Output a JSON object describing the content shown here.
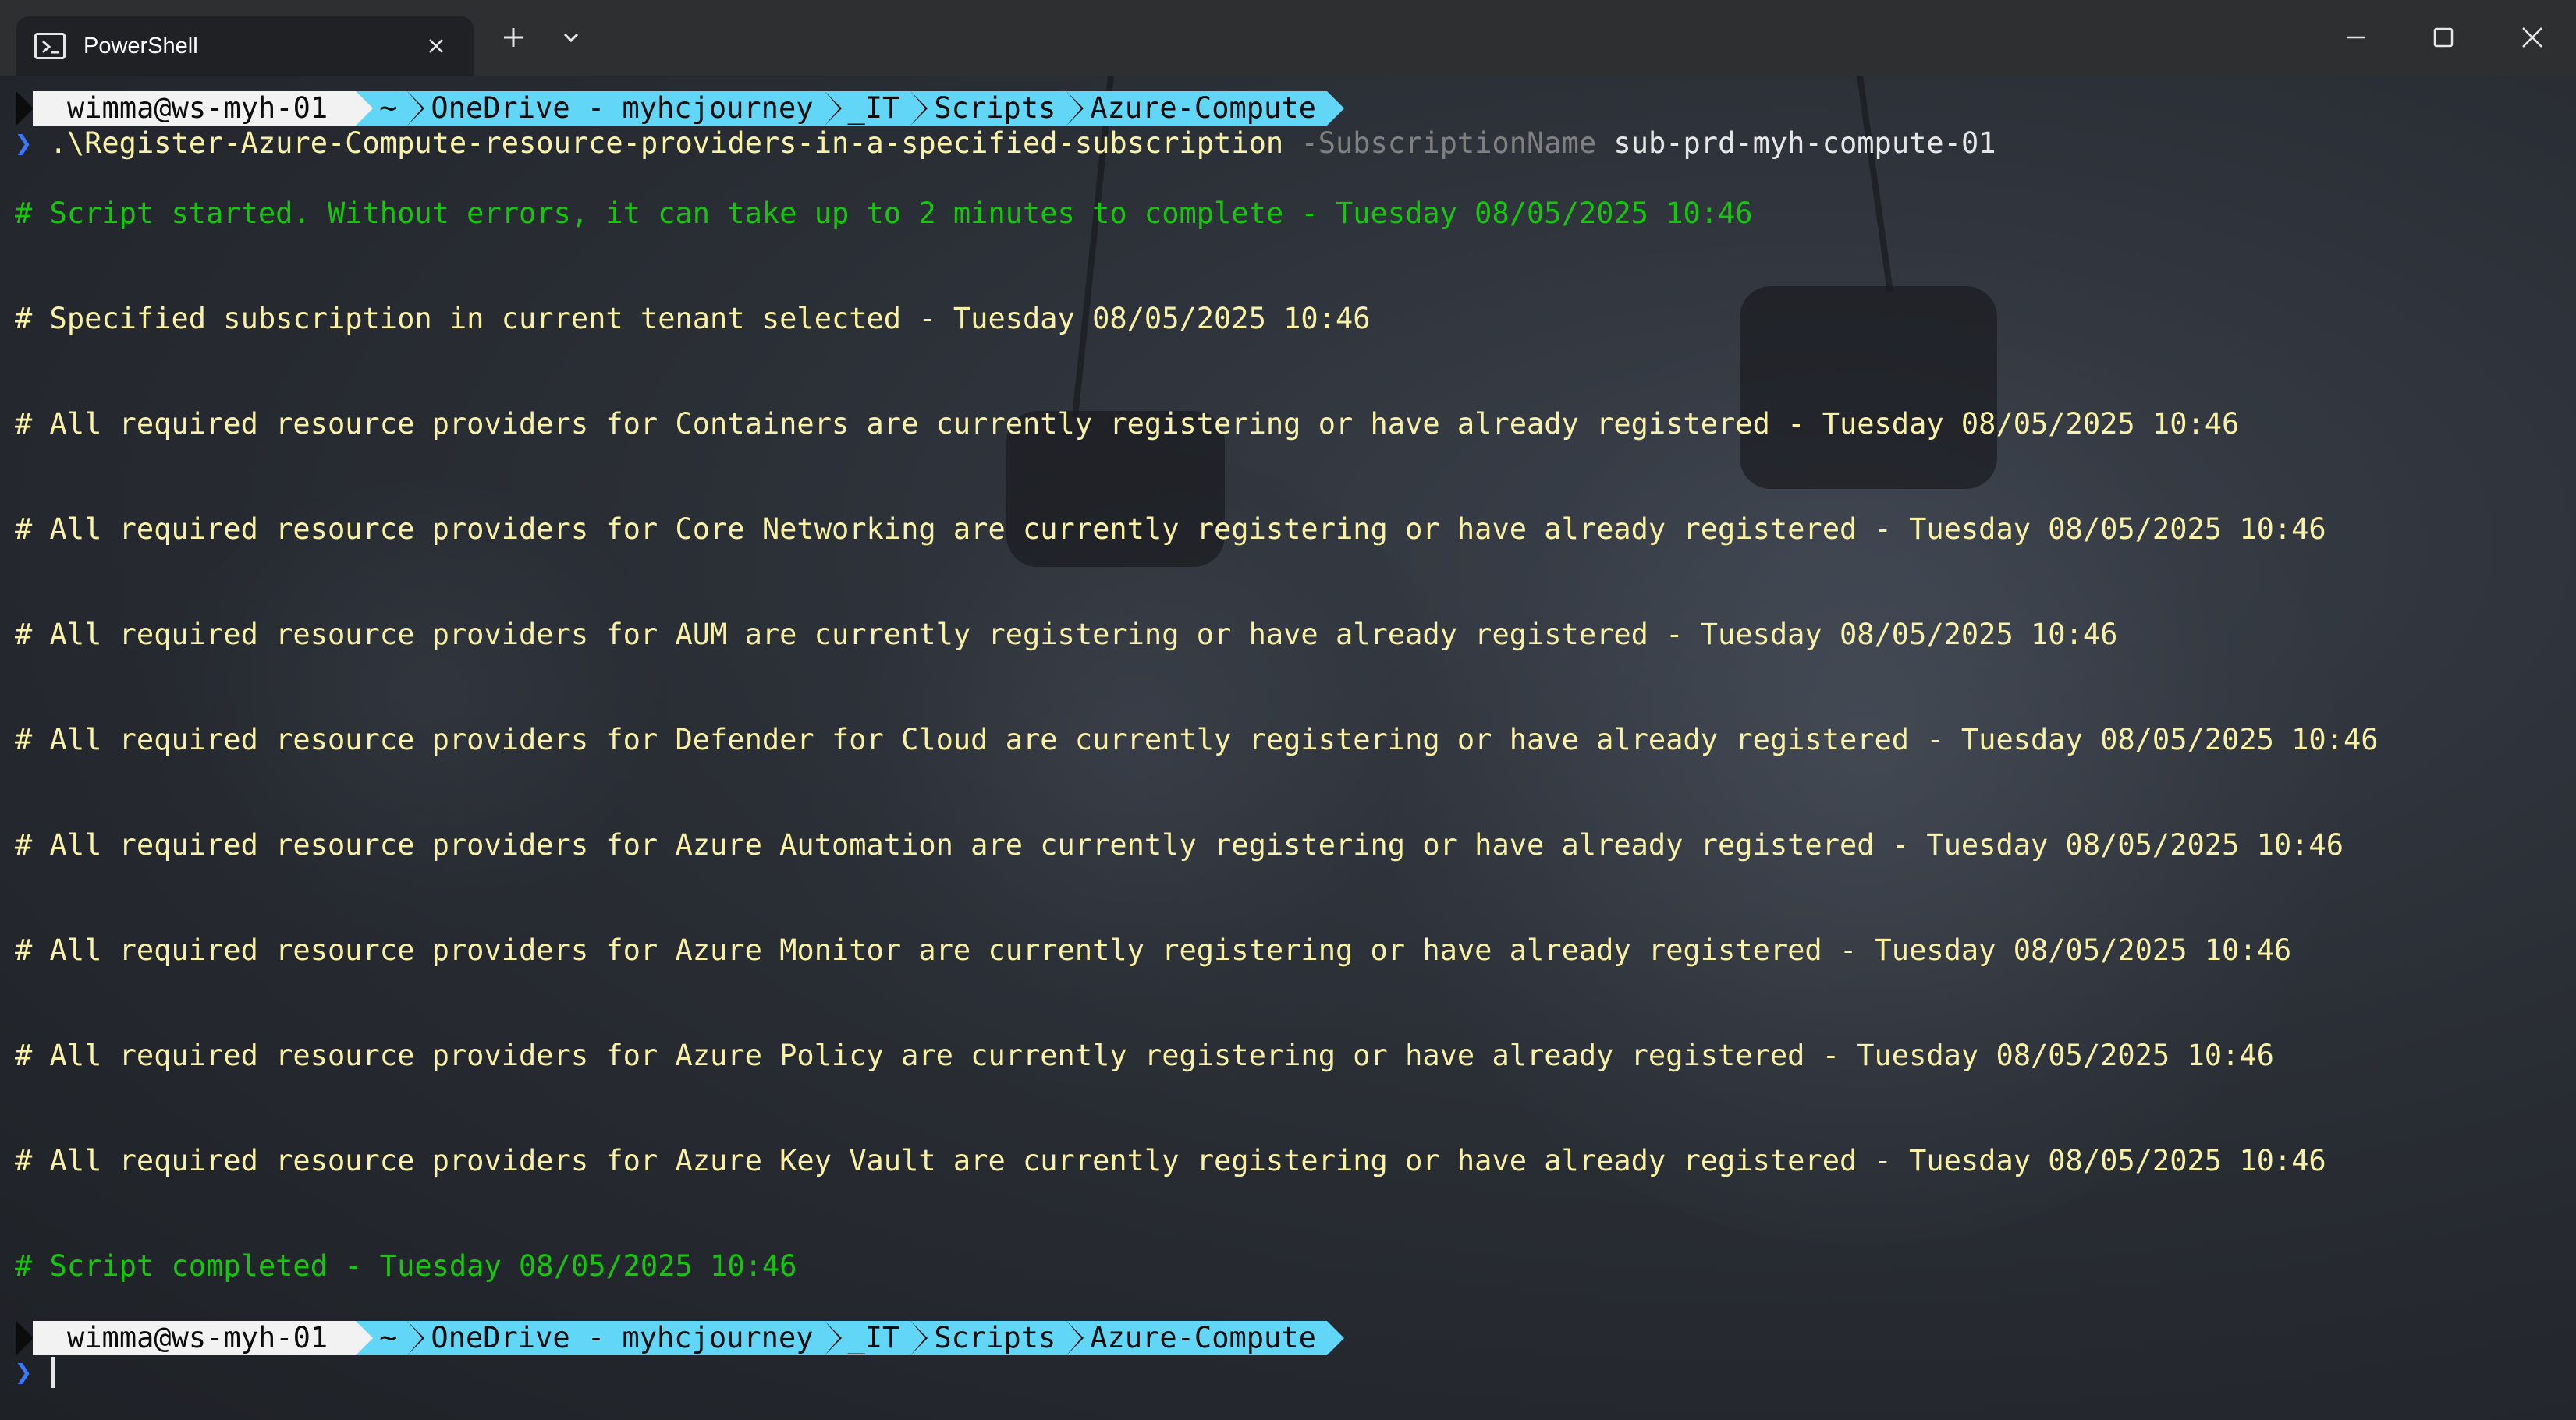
{
  "tab": {
    "title": "PowerShell",
    "icon": "powershell-icon"
  },
  "window_controls": [
    "minimize-icon",
    "maximize-icon",
    "close-icon"
  ],
  "prompt": {
    "user_host": "wimma@ws-myh-01",
    "path": [
      "~",
      "OneDrive - myhcjourney",
      "_IT",
      "Scripts",
      "Azure-Compute"
    ],
    "chevron": "❯"
  },
  "command": {
    "script": ".\\Register-Azure-Compute-resource-providers-in-a-specified-subscription",
    "parameter": "-SubscriptionName",
    "argument": "sub-prd-myh-compute-01"
  },
  "output": {
    "start": "# Script started. Without errors, it can take up to 2 minutes to complete - Tuesday 08/05/2025 10:46",
    "lines": [
      "# Specified subscription in current tenant selected - Tuesday 08/05/2025 10:46",
      "# All required resource providers for Containers are currently registering or have already registered - Tuesday 08/05/2025 10:46",
      "# All required resource providers for Core Networking are currently registering or have already registered - Tuesday 08/05/2025 10:46",
      "# All required resource providers for AUM are currently registering or have already registered - Tuesday 08/05/2025 10:46",
      "# All required resource providers for Defender for Cloud are currently registering or have already registered - Tuesday 08/05/2025 10:46",
      "# All required resource providers for Azure Automation are currently registering or have already registered - Tuesday 08/05/2025 10:46",
      "# All required resource providers for Azure Monitor are currently registering or have already registered - Tuesday 08/05/2025 10:46",
      "# All required resource providers for Azure Policy are currently registering or have already registered - Tuesday 08/05/2025 10:46",
      "# All required resource providers for Azure Key Vault are currently registering or have already registered - Tuesday 08/05/2025 10:46"
    ],
    "end": "# Script completed - Tuesday 08/05/2025 10:46"
  },
  "colors": {
    "green": "#16c60c",
    "yellow": "#f9f1a5",
    "path_segment": "#61d6f6",
    "user_segment": "#f2f2f2",
    "chevron": "#3b78ff"
  }
}
